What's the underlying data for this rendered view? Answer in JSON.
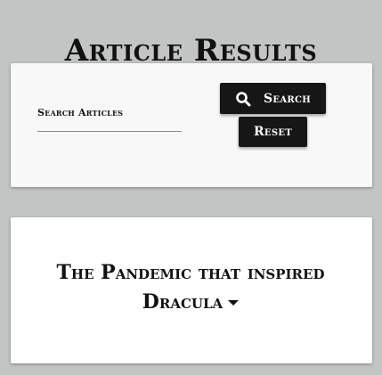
{
  "header": {
    "title": "Article Results"
  },
  "search": {
    "label": "Search Articles",
    "value": "",
    "search_button_label": "Search",
    "search_icon": "search-icon",
    "reset_button_label": "Reset"
  },
  "results": [
    {
      "title": "The Pandemic that inspired Dracula",
      "expand_icon": "caret-down-icon"
    }
  ],
  "colors": {
    "background": "#c3c5c4",
    "card": "#f8f8f8",
    "button": "#161616",
    "button_text": "#ffffff"
  }
}
